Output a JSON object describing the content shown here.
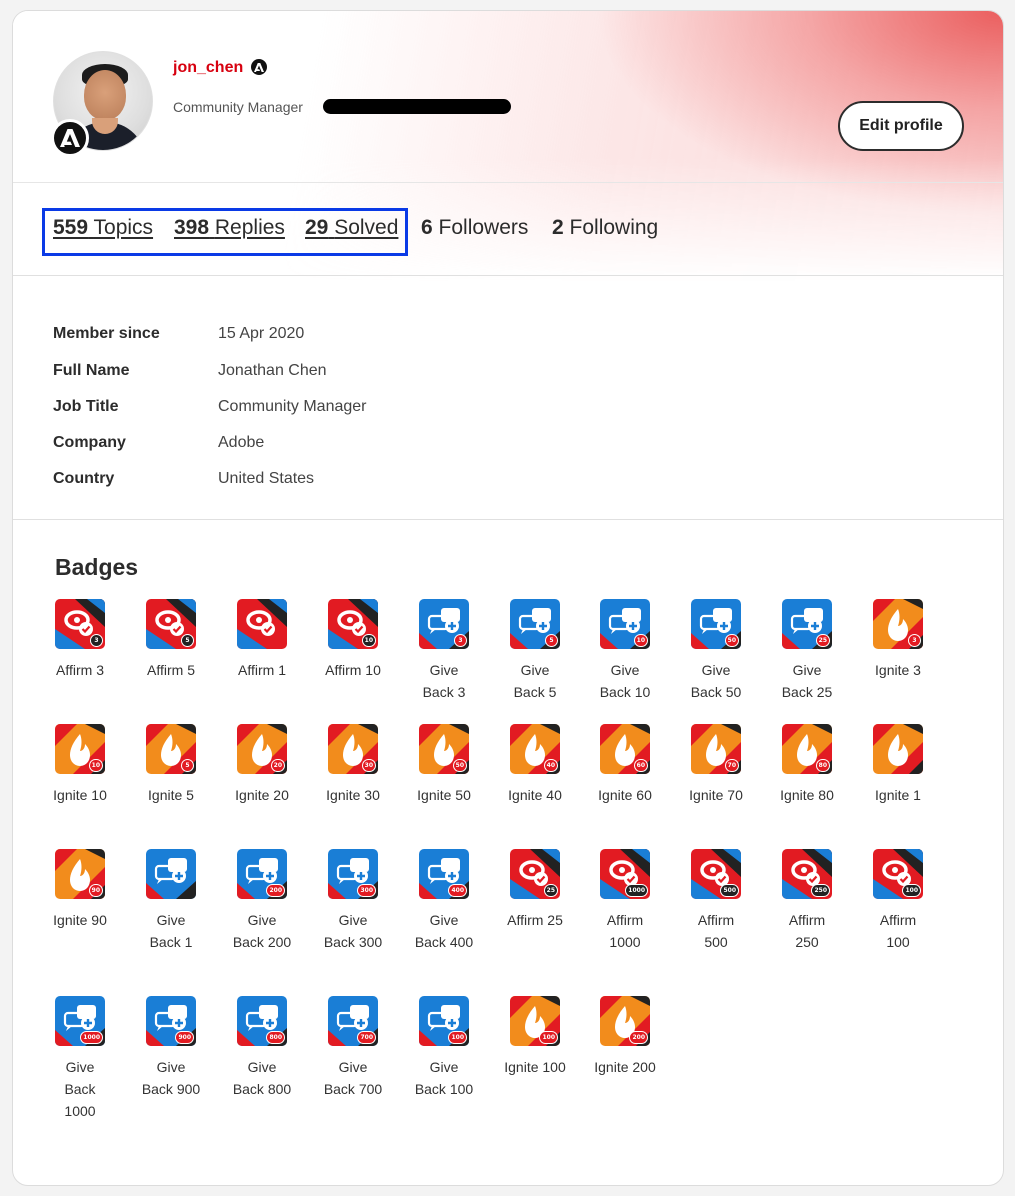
{
  "profile": {
    "username": "jon_chen",
    "role": "Community Manager",
    "edit_label": "Edit profile"
  },
  "stats": {
    "topics": {
      "count": "559",
      "label": "Topics"
    },
    "replies": {
      "count": "398",
      "label": "Replies"
    },
    "solved": {
      "count": "29",
      "label": "Solved"
    },
    "followers": {
      "count": "6",
      "label": "Followers"
    },
    "following": {
      "count": "2",
      "label": "Following"
    }
  },
  "details": [
    {
      "label": "Member since",
      "value": "15 Apr 2020"
    },
    {
      "label": "Full Name",
      "value": "Jonathan Chen"
    },
    {
      "label": "Job Title",
      "value": "Community Manager"
    },
    {
      "label": "Company",
      "value": "Adobe"
    },
    {
      "label": "Country",
      "value": "United States"
    }
  ],
  "badges_title": "Badges",
  "badges": [
    {
      "name": "Affirm 3",
      "type": "affirm",
      "level": "3"
    },
    {
      "name": "Affirm 5",
      "type": "affirm",
      "level": "5"
    },
    {
      "name": "Affirm 1",
      "type": "affirm",
      "level": ""
    },
    {
      "name": "Affirm 10",
      "type": "affirm",
      "level": "10"
    },
    {
      "name": "Give Back 3",
      "type": "giveback",
      "level": "3"
    },
    {
      "name": "Give Back 5",
      "type": "giveback",
      "level": "5"
    },
    {
      "name": "Give Back 10",
      "type": "giveback",
      "level": "10"
    },
    {
      "name": "Give Back 50",
      "type": "giveback",
      "level": "50"
    },
    {
      "name": "Give Back 25",
      "type": "giveback",
      "level": "25"
    },
    {
      "name": "Ignite 3",
      "type": "ignite",
      "level": "3"
    },
    {
      "name": "Ignite 10",
      "type": "ignite",
      "level": "10"
    },
    {
      "name": "Ignite 5",
      "type": "ignite",
      "level": "5"
    },
    {
      "name": "Ignite 20",
      "type": "ignite",
      "level": "20"
    },
    {
      "name": "Ignite 30",
      "type": "ignite",
      "level": "30"
    },
    {
      "name": "Ignite 50",
      "type": "ignite",
      "level": "50"
    },
    {
      "name": "Ignite 40",
      "type": "ignite",
      "level": "40"
    },
    {
      "name": "Ignite 60",
      "type": "ignite",
      "level": "60"
    },
    {
      "name": "Ignite 70",
      "type": "ignite",
      "level": "70"
    },
    {
      "name": "Ignite 80",
      "type": "ignite",
      "level": "80"
    },
    {
      "name": "Ignite 1",
      "type": "ignite",
      "level": ""
    },
    {
      "name": "Ignite 90",
      "type": "ignite",
      "level": "90"
    },
    {
      "name": "Give Back 1",
      "type": "giveback",
      "level": ""
    },
    {
      "name": "Give Back 200",
      "type": "giveback",
      "level": "200"
    },
    {
      "name": "Give Back 300",
      "type": "giveback",
      "level": "300"
    },
    {
      "name": "Give Back 400",
      "type": "giveback",
      "level": "400"
    },
    {
      "name": "Affirm 25",
      "type": "affirm",
      "level": "25"
    },
    {
      "name": "Affirm 1000",
      "type": "affirm",
      "level": "1000"
    },
    {
      "name": "Affirm 500",
      "type": "affirm",
      "level": "500"
    },
    {
      "name": "Affirm 250",
      "type": "affirm",
      "level": "250"
    },
    {
      "name": "Affirm 100",
      "type": "affirm",
      "level": "100"
    },
    {
      "name": "Give Back 1000",
      "type": "giveback",
      "level": "1000"
    },
    {
      "name": "Give Back 900",
      "type": "giveback",
      "level": "900"
    },
    {
      "name": "Give Back 800",
      "type": "giveback",
      "level": "800"
    },
    {
      "name": "Give Back 700",
      "type": "giveback",
      "level": "700"
    },
    {
      "name": "Give Back 100",
      "type": "giveback",
      "level": "100"
    },
    {
      "name": "Ignite 100",
      "type": "ignite",
      "level": "100"
    },
    {
      "name": "Ignite 200",
      "type": "ignite",
      "level": "200"
    }
  ],
  "colors": {
    "username": "#d7000f",
    "highlight_box": "#0a3ae6",
    "affirm_red": "#e21b22",
    "giveback_blue": "#1a7ed6",
    "ignite_orange": "#f28c1c"
  }
}
